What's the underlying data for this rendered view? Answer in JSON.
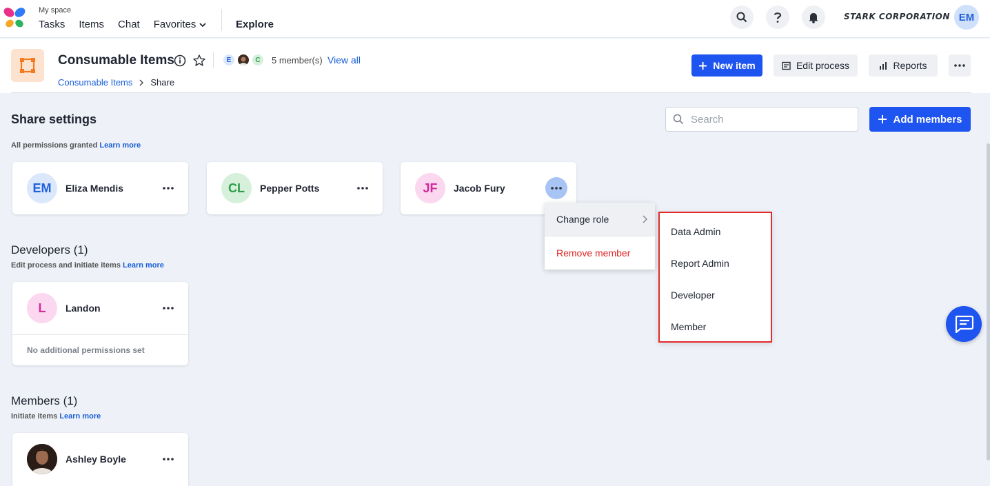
{
  "topnav": {
    "myspace": "My space",
    "links": [
      "Tasks",
      "Items",
      "Chat",
      "Favorites"
    ],
    "explore": "Explore",
    "org_name": "STARK CORPORATION",
    "user_initials": "EM"
  },
  "header": {
    "title": "Consumable Items",
    "member_avatars": [
      "E",
      "",
      "C"
    ],
    "members_count": "5 member(s)",
    "view_all": "View all",
    "breadcrumb": {
      "parent": "Consumable Items",
      "current": "Share"
    },
    "buttons": {
      "new_item": "New item",
      "edit_process": "Edit process",
      "reports": "Reports"
    }
  },
  "share": {
    "title": "Share settings",
    "subtitle": "All permissions granted",
    "learn_more": "Learn more",
    "search_placeholder": "Search",
    "add_members": "Add members"
  },
  "admins": [
    {
      "initials": "EM",
      "name": "Eliza Mendis",
      "bg": "#dbe7fb",
      "fg": "#1f5fd9"
    },
    {
      "initials": "CL",
      "name": "Pepper Potts",
      "bg": "#d7f0dc",
      "fg": "#2d9d4a"
    },
    {
      "initials": "JF",
      "name": "Jacob Fury",
      "bg": "#fbd8ef",
      "fg": "#d02a9c"
    }
  ],
  "developers": {
    "title": "Developers (1)",
    "subtitle": "Edit process and initiate items",
    "learn_more": "Learn more",
    "member": {
      "initials": "L",
      "name": "Landon",
      "bg": "#fbd8ef",
      "fg": "#d02a9c"
    },
    "footer": "No additional permissions set"
  },
  "members": {
    "title": "Members (1)",
    "subtitle": "Initiate items",
    "learn_more": "Learn more",
    "member": {
      "name": "Ashley Boyle"
    }
  },
  "context_menu": {
    "change_role": "Change role",
    "remove_member": "Remove member"
  },
  "role_submenu": [
    "Data Admin",
    "Report Admin",
    "Developer",
    "Member"
  ],
  "colors": {
    "primary": "#1e54f0",
    "danger": "#e02424",
    "highlight_border": "#e12a2a",
    "link": "#1a5fd8"
  }
}
